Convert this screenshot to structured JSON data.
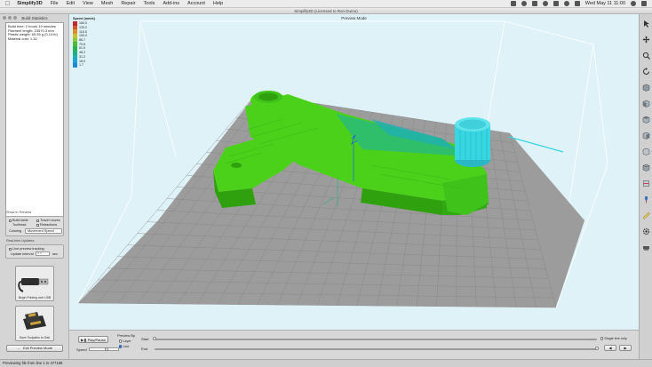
{
  "menubar": {
    "app_name": "Simplify3D",
    "items": [
      "File",
      "Edit",
      "View",
      "Mesh",
      "Repair",
      "Tools",
      "Add-ins",
      "Account",
      "Help"
    ],
    "clock": "Wed May 11  11:00"
  },
  "window": {
    "title": "Simplify3D (Licensed to Ron Dumo)"
  },
  "build_statistics": {
    "title": "Build Statistics",
    "lines": [
      "Build time: 2 hours 19 minutes",
      "Filament length: 23570.3 mm",
      "Plastic weight: 65.95 g (0.14 lb)",
      "Material cost: 1.32"
    ]
  },
  "show_in_preview": {
    "label": "Show in Preview",
    "build_table": "Build table",
    "travel_moves": "Travel moves",
    "toolheads": "Toolhead",
    "retractions": "Retractions",
    "coloring_label": "Coloring",
    "coloring_value": "Movement Speed"
  },
  "realtime": {
    "label": "Real-time Updates",
    "line_preview": "Line preview tracking",
    "update_interval_label": "Update interval",
    "update_interval_value": "5.0",
    "update_interval_unit": "sec"
  },
  "usb_button": {
    "caption": "Begin Printing over USB"
  },
  "sd_button": {
    "caption": "Save Toolpaths to Disk"
  },
  "exit_button": {
    "label": "Exit Preview Mode"
  },
  "viewport": {
    "title": "Preview Mode"
  },
  "legend": {
    "title": "Speed (mm/s)",
    "entries": [
      {
        "value": "150.0",
        "color": "#c1272d"
      },
      {
        "value": "133.2",
        "color": "#d4572a"
      },
      {
        "value": "116.5",
        "color": "#d98f2b"
      },
      {
        "value": "100.0",
        "color": "#c9c22e"
      },
      {
        "value": "86.7",
        "color": "#8dc63f"
      },
      {
        "value": "70.6",
        "color": "#4cba3a"
      },
      {
        "value": "61.0",
        "color": "#2bb24c"
      },
      {
        "value": "48.2",
        "color": "#21b083"
      },
      {
        "value": "31.2",
        "color": "#21b0b0"
      },
      {
        "value": "18.0",
        "color": "#1ea0d8"
      },
      {
        "value": "1.7",
        "color": "#1f8ad0"
      }
    ]
  },
  "toolbar": {
    "tools": [
      "cursor-icon",
      "move-icon",
      "zoom-icon",
      "rotate-icon",
      "cube-view-icon",
      "front-view-icon",
      "top-view-icon",
      "side-view-icon",
      "right-view-icon",
      "iso-view-icon",
      "cross-section-icon",
      "nozzle-icon",
      "measure-icon",
      "settings-icon",
      "bed-icon"
    ]
  },
  "controls": {
    "play_pause": "Play/Pause",
    "speed_label": "Speed",
    "preview_by_label": "Preview By",
    "preview_by_layer": "Layer",
    "preview_by_line": "Line",
    "start_label": "Start",
    "end_label": "End",
    "single_line_only": "Single line only",
    "start_fraction": 0.0,
    "end_fraction": 1.0
  },
  "statusbar": {
    "text": "Previewing file from line 1 to 377188"
  },
  "colors": {
    "part_green": "#4cd11b",
    "part_dark_green": "#2fa10f",
    "part_cyan": "#36d7e2",
    "bed_grey": "#9c9c9c",
    "grid_line": "#858585"
  }
}
